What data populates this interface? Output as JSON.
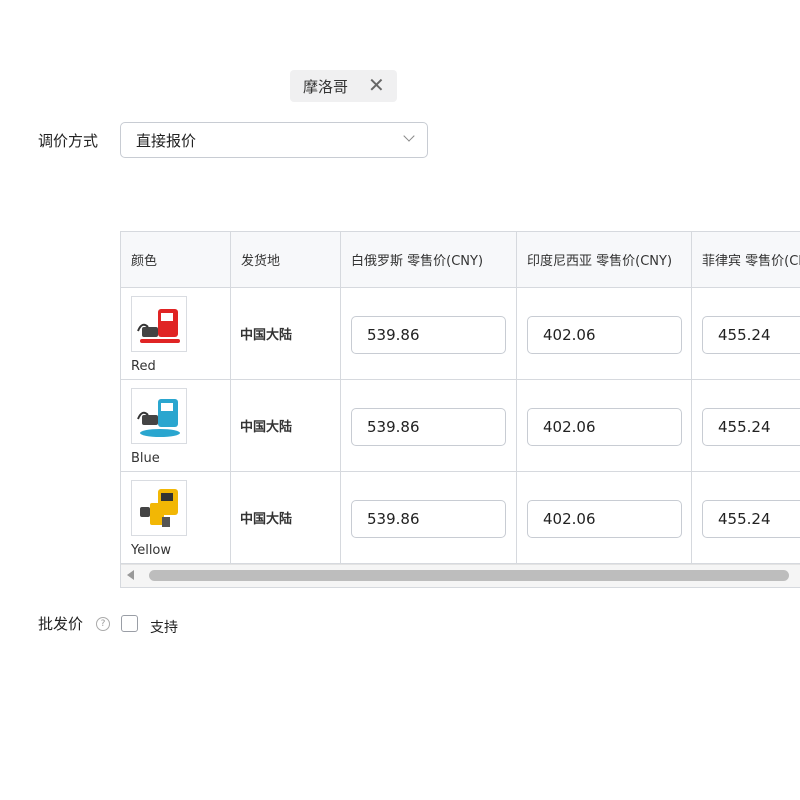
{
  "tag": {
    "label": "摩洛哥",
    "close_glyph": "✕"
  },
  "pricing": {
    "label": "调价方式",
    "selected": "直接报价"
  },
  "table": {
    "headers": [
      "颜色",
      "发货地",
      "白俄罗斯 零售价(CNY)",
      "印度尼西亚 零售价(CNY)",
      "菲律宾 零售价(CNY)"
    ],
    "rows": [
      {
        "color": "Red",
        "origin": "中国大陆",
        "prices": [
          "539.86",
          "402.06",
          "455.24"
        ],
        "accent": "#e02424"
      },
      {
        "color": "Blue",
        "origin": "中国大陆",
        "prices": [
          "539.86",
          "402.06",
          "455.24"
        ],
        "accent": "#2aa6cf"
      },
      {
        "color": "Yellow",
        "origin": "中国大陆",
        "prices": [
          "539.86",
          "402.06",
          "455.24"
        ],
        "accent": "#f2b705"
      }
    ]
  },
  "wholesale": {
    "label": "批发价",
    "hint_icon": "?",
    "checkbox_label": "支持"
  }
}
